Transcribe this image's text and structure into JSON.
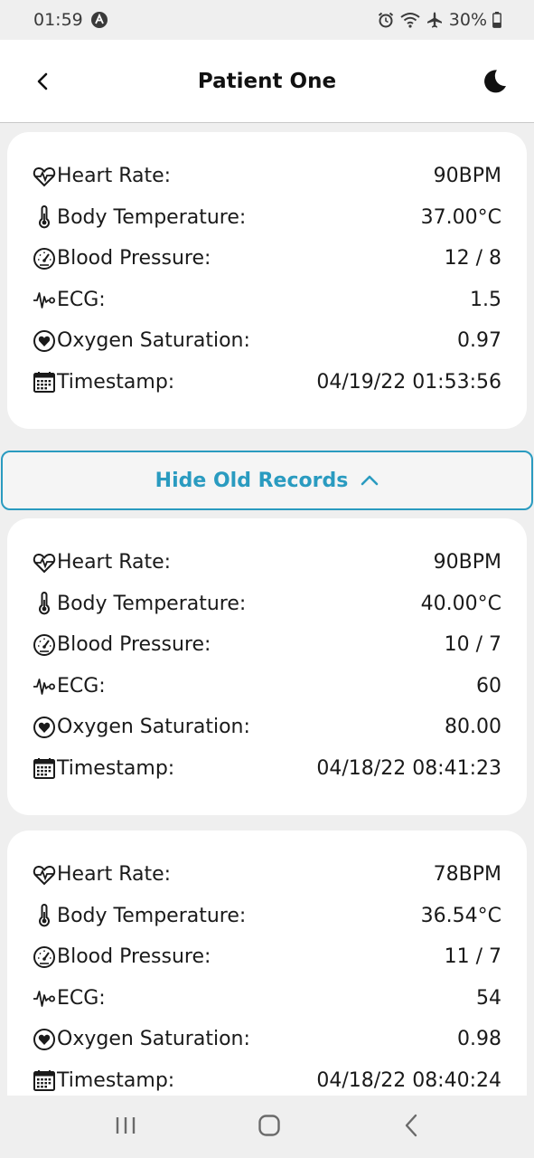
{
  "status_bar": {
    "time": "01:59",
    "battery": "30%"
  },
  "header": {
    "title": "Patient One",
    "back_icon": "chevron-left-icon",
    "theme_icon": "moon-icon"
  },
  "toggle": {
    "label": "Hide Old Records",
    "icon": "chevron-up-icon"
  },
  "colors": {
    "accent": "#2a9bc0",
    "card_bg": "#ffffff",
    "page_bg": "#efefef"
  },
  "records": [
    {
      "heart_rate_label": "Heart Rate:",
      "heart_rate": "90BPM",
      "temperature_label": "Body Temperature:",
      "temperature": "37.00°C",
      "pressure_label": "Blood Pressure:",
      "pressure": "12 / 8",
      "ecg_label": "ECG:",
      "ecg": "1.5",
      "oxygen_label": "Oxygen Saturation:",
      "oxygen": "0.97",
      "timestamp_label": "Timestamp:",
      "timestamp": "04/19/22 01:53:56"
    },
    {
      "heart_rate_label": "Heart Rate:",
      "heart_rate": "90BPM",
      "temperature_label": "Body Temperature:",
      "temperature": "40.00°C",
      "pressure_label": "Blood Pressure:",
      "pressure": "10 / 7",
      "ecg_label": "ECG:",
      "ecg": "60",
      "oxygen_label": "Oxygen Saturation:",
      "oxygen": "80.00",
      "timestamp_label": "Timestamp:",
      "timestamp": "04/18/22 08:41:23"
    },
    {
      "heart_rate_label": "Heart Rate:",
      "heart_rate": "78BPM",
      "temperature_label": "Body Temperature:",
      "temperature": "36.54°C",
      "pressure_label": "Blood Pressure:",
      "pressure": "11 / 7",
      "ecg_label": "ECG:",
      "ecg": "54",
      "oxygen_label": "Oxygen Saturation:",
      "oxygen": "0.98",
      "timestamp_label": "Timestamp:",
      "timestamp": "04/18/22 08:40:24"
    }
  ]
}
